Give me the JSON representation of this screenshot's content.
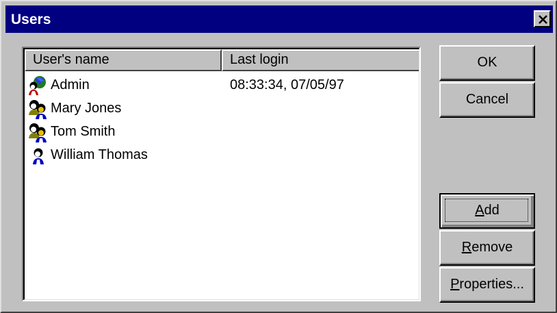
{
  "window": {
    "title": "Users",
    "colors": {
      "titlebar": "#000080",
      "face": "#c0c0c0"
    }
  },
  "list": {
    "columns": [
      "User's name",
      "Last login"
    ],
    "rows": [
      {
        "name": "Admin",
        "last_login": "08:33:34, 07/05/97",
        "icon": "admin-user-icon"
      },
      {
        "name": "Mary Jones",
        "last_login": "",
        "icon": "user-group-icon"
      },
      {
        "name": "Tom Smith",
        "last_login": "",
        "icon": "user-group-icon"
      },
      {
        "name": "William Thomas",
        "last_login": "",
        "icon": "user-icon"
      }
    ]
  },
  "buttons": {
    "ok": "OK",
    "cancel": "Cancel",
    "add": {
      "mnemonic": "A",
      "rest": "dd"
    },
    "remove": {
      "mnemonic": "R",
      "rest": "emove"
    },
    "properties": {
      "mnemonic": "P",
      "rest": "roperties..."
    }
  }
}
